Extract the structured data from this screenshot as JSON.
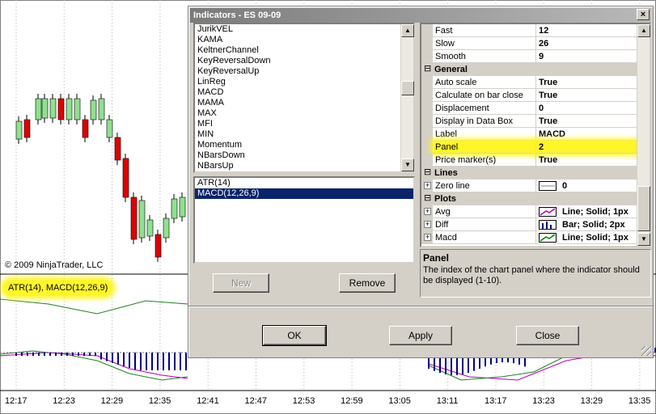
{
  "chart": {
    "copyright": "© 2009 NinjaTrader, LLC",
    "panel2_label": "ATR(14), MACD(12,26,9)",
    "time_axis": [
      "12:17",
      "12:23",
      "12:29",
      "12:35",
      "12:41",
      "12:47",
      "12:53",
      "12:59",
      "13:05",
      "13:11",
      "13:17",
      "13:23",
      "13:29",
      "13:35"
    ],
    "up_color": "#90e090",
    "down_color": "#e00000",
    "highlight_color": "#fff51e"
  },
  "dialog": {
    "title": "Indicators - ES 09-09",
    "close_glyph": "×",
    "available_indicators": [
      "JurikVEL",
      "KAMA",
      "KeltnerChannel",
      "KeyReversalDown",
      "KeyReversalUp",
      "LinReg",
      "MACD",
      "MAMA",
      "MAX",
      "MFI",
      "MIN",
      "Momentum",
      "NBarsDown",
      "NBarsUp"
    ],
    "applied_indicators": [
      {
        "label": "ATR(14)",
        "selected": false
      },
      {
        "label": "MACD(12,26,9)",
        "selected": true
      }
    ],
    "buttons": {
      "new": "New",
      "remove": "Remove",
      "ok": "OK",
      "apply": "Apply",
      "close": "Close"
    },
    "properties": {
      "rows": [
        {
          "type": "prop",
          "name": "Fast",
          "value": "12"
        },
        {
          "type": "prop",
          "name": "Slow",
          "value": "26"
        },
        {
          "type": "prop",
          "name": "Smooth",
          "value": "9"
        },
        {
          "type": "category",
          "name": "General",
          "expander": "⊟"
        },
        {
          "type": "prop",
          "name": "Auto scale",
          "value": "True"
        },
        {
          "type": "prop",
          "name": "Calculate on bar close",
          "value": "True"
        },
        {
          "type": "prop",
          "name": "Displacement",
          "value": "0"
        },
        {
          "type": "prop",
          "name": "Display in Data Box",
          "value": "True"
        },
        {
          "type": "prop",
          "name": "Label",
          "value": "MACD"
        },
        {
          "type": "prop",
          "name": "Panel",
          "value": "2",
          "highlight": true
        },
        {
          "type": "prop",
          "name": "Price marker(s)",
          "value": "True"
        },
        {
          "type": "category",
          "name": "Lines",
          "expander": "⊟"
        },
        {
          "type": "expandable",
          "name": "Zero line",
          "value": "0",
          "swatch": "zero-line"
        },
        {
          "type": "category",
          "name": "Plots",
          "expander": "⊟"
        },
        {
          "type": "expandable",
          "name": "Avg",
          "value": "Line; Solid; 1px",
          "swatch": "line-purple"
        },
        {
          "type": "expandable",
          "name": "Diff",
          "value": "Bar; Solid; 2px",
          "swatch": "bar-navy"
        },
        {
          "type": "expandable",
          "name": "Macd",
          "value": "Line; Solid; 1px",
          "swatch": "line-green"
        }
      ]
    },
    "description": {
      "title": "Panel",
      "text": "The index of the chart panel where the indicator should be displayed (1-10)."
    },
    "plot_colors": {
      "avg": "#b000c0",
      "diff": "#000080",
      "macd": "#008000"
    }
  }
}
